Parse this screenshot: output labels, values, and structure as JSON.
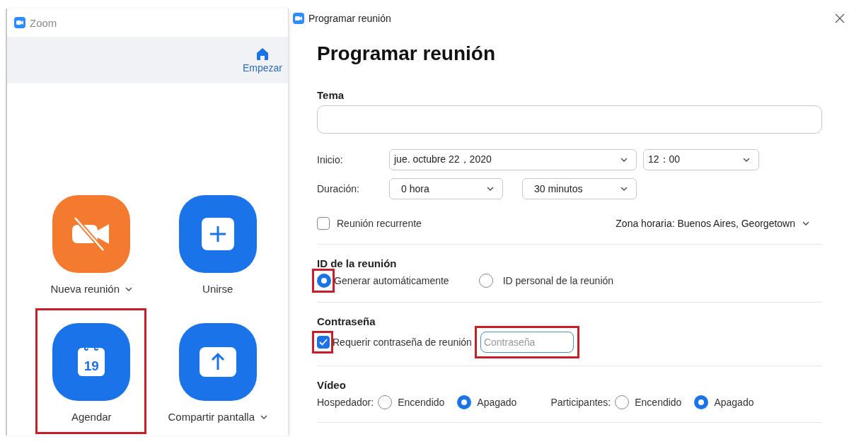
{
  "main_window": {
    "title": "Zoom",
    "nav": {
      "label": "Empezar",
      "selected": true
    },
    "actions": [
      {
        "label": "Nueva reunión",
        "kind": "video-off",
        "color": "#f47a2f",
        "dropdown": true,
        "highlighted": false
      },
      {
        "label": "Unirse",
        "kind": "plus",
        "color": "#1a73e8",
        "dropdown": false,
        "highlighted": false
      },
      {
        "label": "Agendar",
        "kind": "calendar",
        "icon_text": "19",
        "color": "#1a73e8",
        "dropdown": false,
        "highlighted": true
      },
      {
        "label": "Compartir pantalla",
        "kind": "share",
        "color": "#1a73e8",
        "dropdown": true,
        "highlighted": false
      }
    ]
  },
  "dialog": {
    "title": "Programar reunión",
    "heading": "Programar reunión",
    "topic": {
      "label": "Tema"
    },
    "start": {
      "label": "Inicio:",
      "date": "jue.  octubre  22，2020",
      "time": "12：00"
    },
    "duration": {
      "label": "Duración:",
      "hours": "0 hora",
      "minutes": "30 minutos"
    },
    "recurring": {
      "label": "Reunión recurrente",
      "checked": false
    },
    "timezone": "Zona horaria: Buenos Aires, Georgetown",
    "meeting_id": {
      "title": "ID de la reunión",
      "options": [
        {
          "label": "Generar automáticamente",
          "selected": true,
          "highlighted": true
        },
        {
          "label": "ID personal de la reunión",
          "selected": false,
          "highlighted": false
        }
      ]
    },
    "password": {
      "title": "Contraseña",
      "require": {
        "label": "Requerir contraseña de reunión",
        "checked": true,
        "highlighted": true
      },
      "field": {
        "placeholder": "Contraseña",
        "highlighted": true
      }
    },
    "video": {
      "title": "Vídeo",
      "groups": [
        {
          "label": "Hospedador:",
          "options": [
            {
              "label": "Encendido",
              "selected": false
            },
            {
              "label": "Apagado",
              "selected": true
            }
          ]
        },
        {
          "label": "Participantes:",
          "options": [
            {
              "label": "Encendido",
              "selected": false
            },
            {
              "label": "Apagado",
              "selected": true
            }
          ]
        }
      ]
    }
  }
}
